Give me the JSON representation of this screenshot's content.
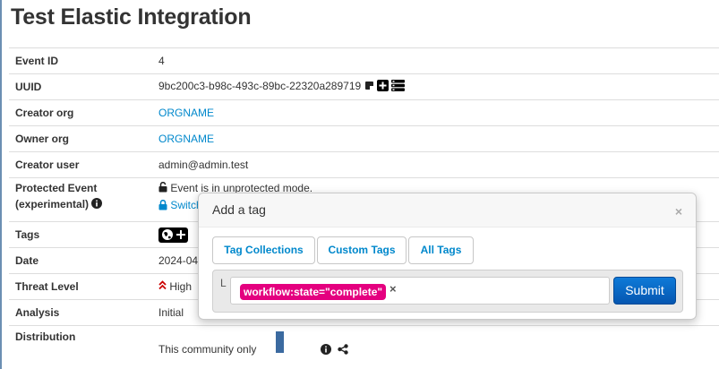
{
  "page": {
    "title": "Test Elastic Integration"
  },
  "details": {
    "event_id": {
      "label": "Event ID",
      "value": "4"
    },
    "uuid": {
      "label": "UUID",
      "value": "9bc200c3-b98c-493c-89bc-22320a289719"
    },
    "creator_org": {
      "label": "Creator org",
      "value": "ORGNAME"
    },
    "owner_org": {
      "label": "Owner org",
      "value": "ORGNAME"
    },
    "creator_user": {
      "label": "Creator user",
      "value": "admin@admin.test"
    },
    "protected_event": {
      "label": "Protected Event",
      "label2": "(experimental)",
      "status": "Event is in unprotected mode.",
      "action": "Switch"
    },
    "tags": {
      "label": "Tags"
    },
    "date": {
      "label": "Date",
      "value": "2024-04"
    },
    "threat_level": {
      "label": "Threat Level",
      "value": "High"
    },
    "analysis": {
      "label": "Analysis",
      "value": "Initial"
    },
    "distribution": {
      "label": "Distribution",
      "value": "This community only"
    }
  },
  "popover": {
    "title": "Add a tag",
    "close": "×",
    "tabs": [
      "Tag Collections",
      "Custom Tags",
      "All Tags"
    ],
    "marker": "L",
    "selected_tag": "workflow:state=\"complete\"",
    "remove": "×",
    "submit": "Submit"
  },
  "colors": {
    "link": "#0088cc",
    "tag_chip": "#e4007f",
    "submit": "#0a67c7",
    "threat_high": "#cc0000"
  }
}
